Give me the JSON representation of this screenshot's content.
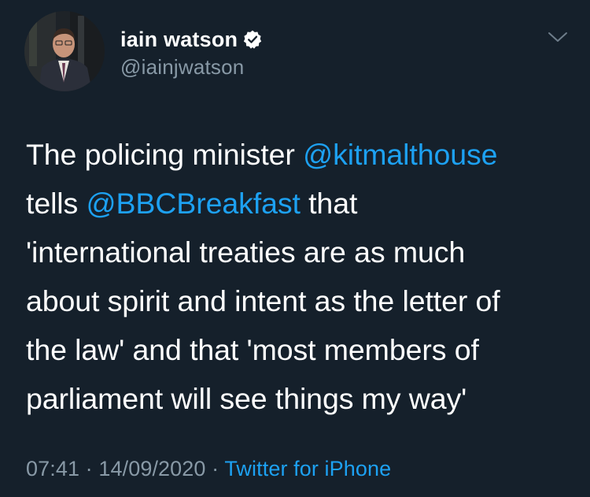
{
  "author": {
    "display_name": "iain watson",
    "handle": "@iainjwatson",
    "verified": true
  },
  "tweet": {
    "lines": [
      {
        "pre": "The policing minister ",
        "mention": "@kitmalthouse",
        "post": ""
      },
      {
        "pre": "tells ",
        "mention": "@BBCBreakfast",
        "post": " that"
      },
      {
        "pre": "'international treaties are as much",
        "mention": "",
        "post": ""
      },
      {
        "pre": "about spirit and intent as the letter of",
        "mention": "",
        "post": ""
      },
      {
        "pre": "the law' and that 'most members of",
        "mention": "",
        "post": ""
      },
      {
        "pre": "parliament will see things my way'",
        "mention": "",
        "post": ""
      }
    ]
  },
  "meta": {
    "time": "07:41",
    "separator1": " · ",
    "date": "14/09/2020",
    "separator2": " · ",
    "source": "Twitter for iPhone"
  },
  "icons": {
    "verified": "verified-badge-icon",
    "menu": "chevron-down-icon"
  },
  "colors": {
    "background": "#15202b",
    "text": "#ffffff",
    "secondary": "#8899a6",
    "link": "#1da1f2"
  }
}
